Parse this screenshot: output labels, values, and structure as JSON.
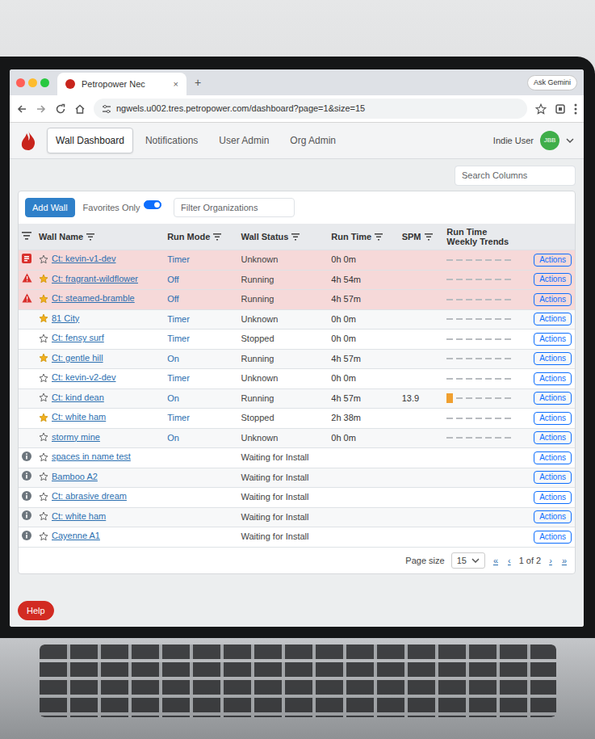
{
  "browser": {
    "tab_title": "Petropower Nec",
    "close": "×",
    "new_tab": "+",
    "badge": "Ask Gemini",
    "url": "ngwels.u002.tres.petropower.com/dashboard?page=1&size=15"
  },
  "app": {
    "tabs": [
      {
        "label": "Wall Dashboard",
        "selected": true
      },
      {
        "label": "Notifications",
        "selected": false
      },
      {
        "label": "User Admin",
        "selected": false
      },
      {
        "label": "Org Admin",
        "selected": false
      }
    ],
    "user": "Indie User",
    "avatar": "JBB",
    "search": {
      "placeholder": "Search Columns"
    }
  },
  "toolbar": {
    "add_button": "Add Wall",
    "favorites": {
      "label": "Favorites Only",
      "on": true
    },
    "filter": {
      "placeholder": "Filter Organizations"
    }
  },
  "table": {
    "columns": [
      {
        "label": "Wall Name",
        "sortable": true
      },
      {
        "label": "Run Mode",
        "sortable": true
      },
      {
        "label": "Wall Status",
        "sortable": true
      },
      {
        "label": "Run Time",
        "sortable": true
      },
      {
        "label": "SPM",
        "sortable": true
      },
      {
        "label": "Run Time Weekly Trends",
        "sortable": false
      }
    ],
    "rows": [
      {
        "kind": "error",
        "highlighted": true,
        "favorite": false,
        "name": "Ct: kevin-v1-dev",
        "run_mode": "Timer",
        "status": "Unknown",
        "run_time": "0h 0m",
        "trend": [
          0,
          0,
          0,
          0,
          0,
          0,
          0
        ],
        "action": "Actions"
      },
      {
        "kind": "warning",
        "highlighted": true,
        "favorite": true,
        "name": "Ct: fragrant-wildflower",
        "run_mode": "Off",
        "status": "Running",
        "run_time": "4h 54m",
        "trend": [
          0,
          0,
          0,
          0,
          0,
          0,
          0
        ],
        "action": "Actions"
      },
      {
        "kind": "warning",
        "highlighted": true,
        "favorite": true,
        "name": "Ct: steamed-bramble",
        "run_mode": "Off",
        "status": "Running",
        "run_time": "4h 57m",
        "trend": [
          0,
          0,
          0,
          0,
          0,
          0,
          0
        ],
        "action": "Actions"
      },
      {
        "kind": "none",
        "highlighted": false,
        "favorite": true,
        "name": "81 City",
        "run_mode": "Timer",
        "status": "Unknown",
        "run_time": "0h 0m",
        "trend": [
          0,
          0,
          0,
          0,
          0,
          0,
          0
        ],
        "action": "Actions"
      },
      {
        "kind": "none",
        "highlighted": false,
        "favorite": false,
        "name": "Ct: fensy surf",
        "run_mode": "Timer",
        "status": "Stopped",
        "run_time": "0h 0m",
        "trend": [
          0,
          0,
          0,
          0,
          0,
          0,
          0
        ],
        "action": "Actions"
      },
      {
        "kind": "none",
        "highlighted": false,
        "favorite": true,
        "name": "Ct: gentle hill",
        "run_mode": "On",
        "status": "Running",
        "run_time": "4h 57m",
        "trend": [
          0,
          0,
          0,
          0,
          0,
          0,
          0
        ],
        "action": "Actions"
      },
      {
        "kind": "none",
        "highlighted": false,
        "favorite": false,
        "name": "Ct: kevin-v2-dev",
        "run_mode": "Timer",
        "status": "Unknown",
        "run_time": "0h 0m",
        "trend": [
          0,
          0,
          0,
          0,
          0,
          0,
          0
        ],
        "action": "Actions"
      },
      {
        "kind": "none",
        "highlighted": false,
        "favorite": false,
        "name": "Ct: kind dean",
        "run_mode": "On",
        "status": "Running",
        "run_time": "4h 57m",
        "spm": "13.9",
        "trend": [
          5,
          0,
          0,
          0,
          0,
          0,
          0
        ],
        "action": "Actions"
      },
      {
        "kind": "none",
        "highlighted": false,
        "favorite": true,
        "name": "Ct: white ham",
        "run_mode": "Timer",
        "status": "Stopped",
        "run_time": "2h 38m",
        "trend": [
          0,
          0,
          0,
          0,
          0,
          0,
          0
        ],
        "action": "Actions"
      },
      {
        "kind": "none",
        "highlighted": false,
        "favorite": false,
        "name": "stormy mine",
        "run_mode": "On",
        "status": "Unknown",
        "run_time": "0h 0m",
        "trend": [
          0,
          0,
          0,
          0,
          0,
          0,
          0
        ],
        "action": "Actions"
      },
      {
        "kind": "info",
        "highlighted": false,
        "favorite": false,
        "name": "spaces in name test",
        "status": "Waiting for Install",
        "action": "Actions"
      },
      {
        "kind": "info",
        "highlighted": false,
        "favorite": false,
        "name": "Bamboo A2",
        "status": "Waiting for Install",
        "action": "Actions"
      },
      {
        "kind": "info",
        "highlighted": false,
        "favorite": false,
        "name": "Ct: abrasive dream",
        "status": "Waiting for Install",
        "action": "Actions"
      },
      {
        "kind": "info",
        "highlighted": false,
        "favorite": false,
        "name": "Ct: white ham",
        "status": "Waiting for Install",
        "action": "Actions"
      },
      {
        "kind": "info",
        "highlighted": false,
        "favorite": false,
        "name": "Cayenne A1",
        "status": "Waiting for Install",
        "action": "Actions"
      }
    ]
  },
  "pagination": {
    "label": "Page size",
    "size": "15",
    "first": "«",
    "prev": "‹",
    "info": "1 of 2",
    "next": "›",
    "last": "»"
  },
  "help": "Help"
}
